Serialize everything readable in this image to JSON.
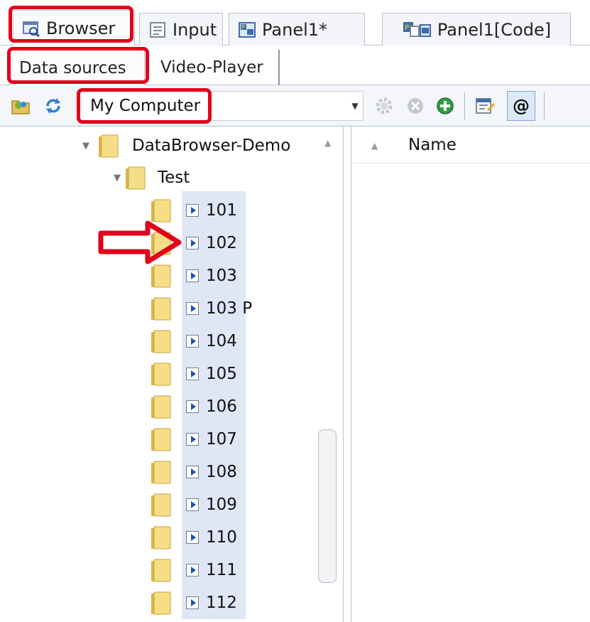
{
  "tabs": [
    {
      "label": "Browser",
      "icon": "browser-icon"
    },
    {
      "label": "Input",
      "icon": "input-form-icon"
    },
    {
      "label": "Panel1*",
      "icon": "panel-icon"
    },
    {
      "label": "Panel1[Code]",
      "icon": "panel-code-icon"
    }
  ],
  "subtabs": [
    {
      "label": "Data sources"
    },
    {
      "label": "Video-Player"
    }
  ],
  "toolbar": {
    "source_combo_value": "My Computer",
    "icons": [
      "open-folder-icon",
      "refresh-icon",
      "settings-gear-icon",
      "remove-icon",
      "add-icon",
      "properties-icon",
      "at-sign-icon"
    ],
    "at_label": "@"
  },
  "tree": {
    "root": {
      "label": "DataBrowser-Demo",
      "expanded": true
    },
    "child": {
      "label": "Test",
      "expanded": true
    },
    "items": [
      "101",
      "102",
      "103",
      "103 P",
      "104",
      "105",
      "106",
      "107",
      "108",
      "109",
      "110",
      "111",
      "112"
    ]
  },
  "list": {
    "column_name": "Name"
  },
  "colors": {
    "highlight": "#e3001b",
    "selection": "#dfe6f6",
    "folder": "#f3d77c",
    "play": "#1e4fb8"
  }
}
